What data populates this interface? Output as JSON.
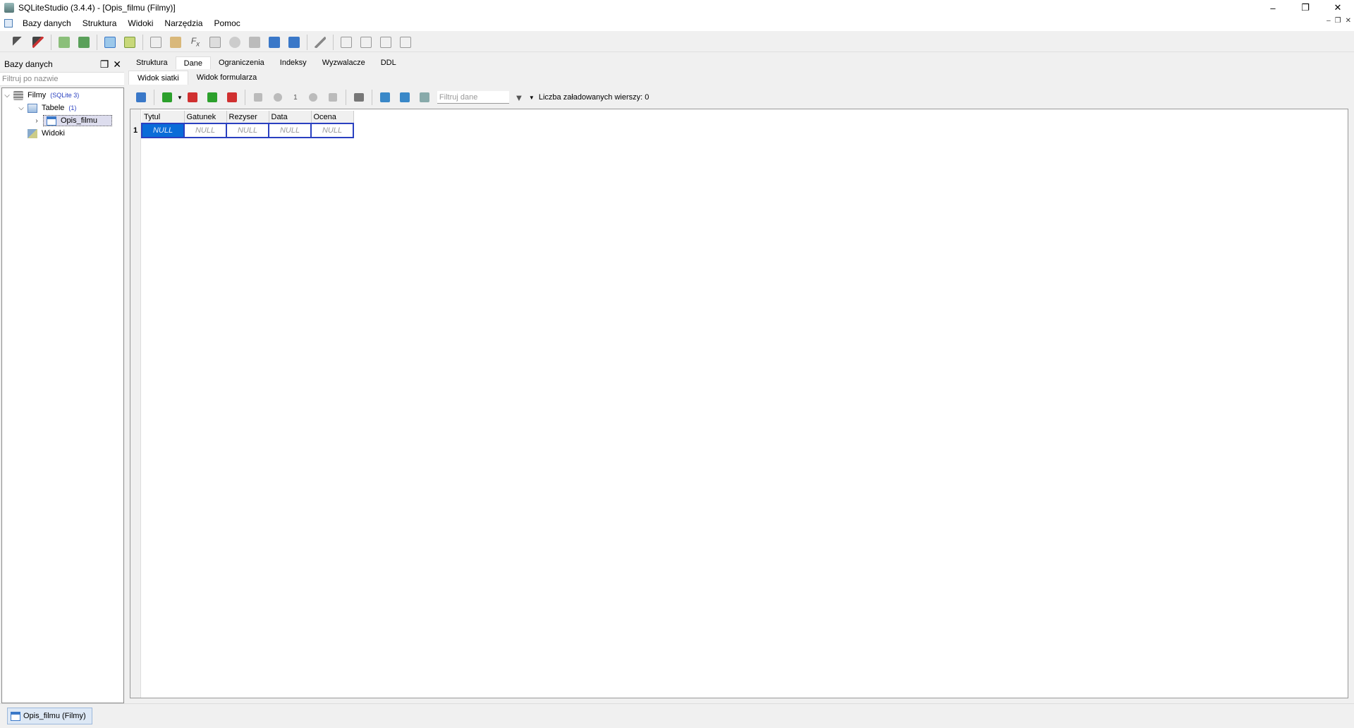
{
  "window": {
    "title": "SQLiteStudio (3.4.4) - [Opis_filmu (Filmy)]"
  },
  "menu": [
    "Bazy danych",
    "Struktura",
    "Widoki",
    "Narzędzia",
    "Pomoc"
  ],
  "dock": {
    "title": "Bazy danych",
    "filter_placeholder": "Filtruj po nazwie"
  },
  "tree": {
    "db_name": "Filmy",
    "db_tag": "(SQLite 3)",
    "tables_label": "Tabele",
    "tables_count": "(1)",
    "table_name": "Opis_filmu",
    "views_label": "Widoki"
  },
  "tabs": [
    "Struktura",
    "Dane",
    "Ograniczenia",
    "Indeksy",
    "Wyzwalacze",
    "DDL"
  ],
  "active_tab": "Dane",
  "subtabs": [
    "Widok siatki",
    "Widok formularza"
  ],
  "data_toolbar": {
    "page": "1",
    "filter_placeholder": "Filtruj dane",
    "rows_loaded": "Liczba załadowanych wierszy: 0"
  },
  "grid": {
    "columns": [
      "Tytul",
      "Gatunek",
      "Rezyser",
      "Data",
      "Ocena"
    ],
    "rows": [
      [
        "NULL",
        "NULL",
        "NULL",
        "NULL",
        "NULL"
      ]
    ],
    "row_numbers": [
      "1"
    ]
  },
  "taskbar": {
    "item": "Opis_filmu (Filmy)"
  },
  "colors": {
    "accent": "#2a40c0",
    "selection": "#0a6cd8"
  }
}
